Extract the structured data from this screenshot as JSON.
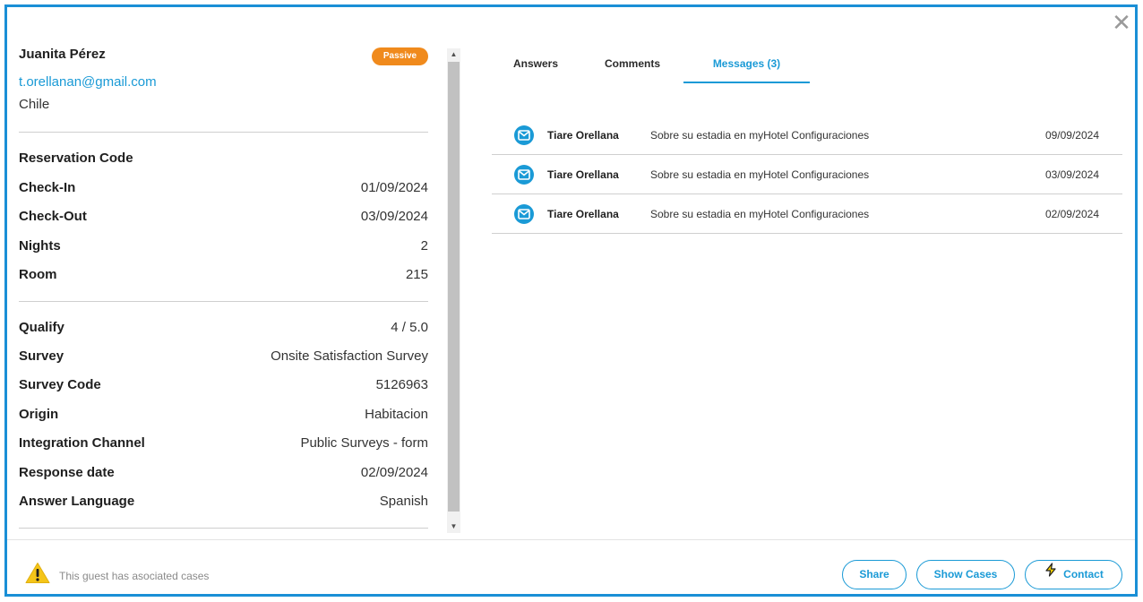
{
  "guest": {
    "name": "Juanita Pérez",
    "status_badge": "Passive",
    "email": "t.orellanan@gmail.com",
    "country": "Chile"
  },
  "reservation": {
    "title": "Reservation Code",
    "rows": [
      {
        "label": "Check-In",
        "value": "01/09/2024"
      },
      {
        "label": "Check-Out",
        "value": "03/09/2024"
      },
      {
        "label": "Nights",
        "value": "2"
      },
      {
        "label": "Room",
        "value": "215"
      }
    ]
  },
  "survey": {
    "rows": [
      {
        "label": "Qualify",
        "value": "4 / 5.0"
      },
      {
        "label": "Survey",
        "value": "Onsite Satisfaction Survey"
      },
      {
        "label": "Survey Code",
        "value": "5126963"
      },
      {
        "label": "Origin",
        "value": "Habitacion"
      },
      {
        "label": "Integration Channel",
        "value": "Public Surveys - form"
      },
      {
        "label": "Response date",
        "value": "02/09/2024"
      },
      {
        "label": "Answer Language",
        "value": "Spanish"
      }
    ]
  },
  "tabs": [
    {
      "label": "Answers"
    },
    {
      "label": "Comments"
    },
    {
      "label": "Messages (3)"
    }
  ],
  "messages": [
    {
      "icon": "envelope-icon",
      "sender": "Tiare Orellana",
      "subject": "Sobre su estadia en myHotel Configuraciones",
      "date": "09/09/2024"
    },
    {
      "icon": "envelope-icon",
      "sender": "Tiare Orellana",
      "subject": "Sobre su estadia en myHotel Configuraciones",
      "date": "03/09/2024"
    },
    {
      "icon": "envelope-icon",
      "sender": "Tiare Orellana",
      "subject": "Sobre su estadia en myHotel Configuraciones",
      "date": "02/09/2024"
    }
  ],
  "footer": {
    "warning_icon": "warning-triangle-icon",
    "notice": "This guest has asociated cases",
    "share_label": "Share",
    "show_cases_label": "Show Cases",
    "contact_label": "Contact"
  },
  "close_icon": "close-icon",
  "colors": {
    "accent": "#1a9ad6",
    "border": "#1a8fd6",
    "badge": "#f08a1c",
    "warning": "#f5c518"
  }
}
